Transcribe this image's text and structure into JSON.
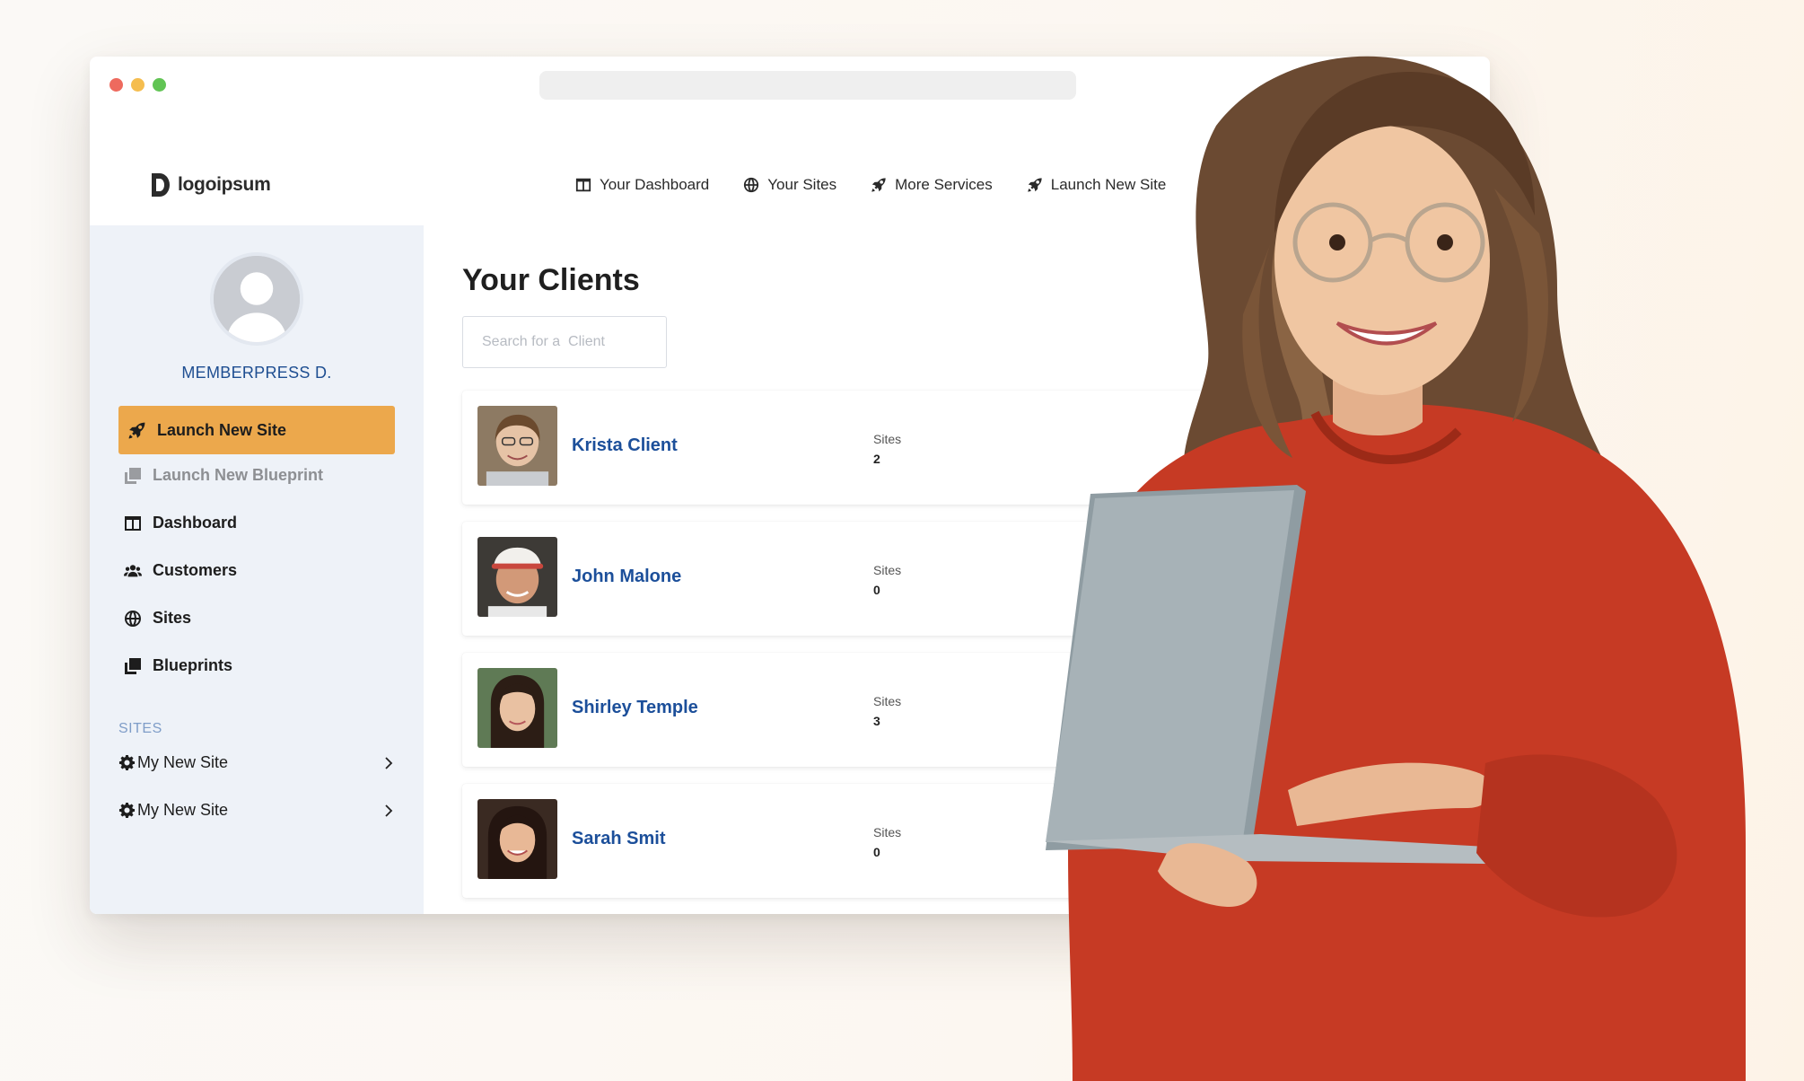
{
  "topnav": {
    "brand": "logoipsum",
    "items": [
      {
        "label": "Your Dashboard",
        "icon": "columns-icon"
      },
      {
        "label": "Your Sites",
        "icon": "globe-icon"
      },
      {
        "label": "More Services",
        "icon": "rocket-icon"
      },
      {
        "label": "Launch New Site",
        "icon": "rocket-icon"
      }
    ]
  },
  "sidebar": {
    "user_name": "MEMBERPRESS D.",
    "launch_button": "Launch New Site",
    "items": [
      {
        "label": "Launch New Blueprint",
        "icon": "copy-icon"
      },
      {
        "label": "Dashboard",
        "icon": "columns-icon"
      },
      {
        "label": "Customers",
        "icon": "users-icon"
      },
      {
        "label": "Sites",
        "icon": "globe-icon"
      },
      {
        "label": "Blueprints",
        "icon": "copy-icon"
      }
    ],
    "sites_heading": "SITES",
    "sites": [
      {
        "label": "My New Site"
      },
      {
        "label": "My New Site"
      }
    ]
  },
  "main": {
    "title": "Your Clients",
    "search_placeholder": "Search for a  Client",
    "sites_label": "Sites",
    "clients": [
      {
        "name": "Krista Client",
        "sites": "2"
      },
      {
        "name": "John Malone",
        "sites": "0"
      },
      {
        "name": "Shirley Temple",
        "sites": "3"
      },
      {
        "name": "Sarah Smit",
        "sites": "0"
      }
    ]
  },
  "colors": {
    "accent": "#eca84c",
    "link": "#1c4f9a",
    "sidebar_bg": "#eef2f8",
    "button_blue": "#3d8bd1"
  }
}
